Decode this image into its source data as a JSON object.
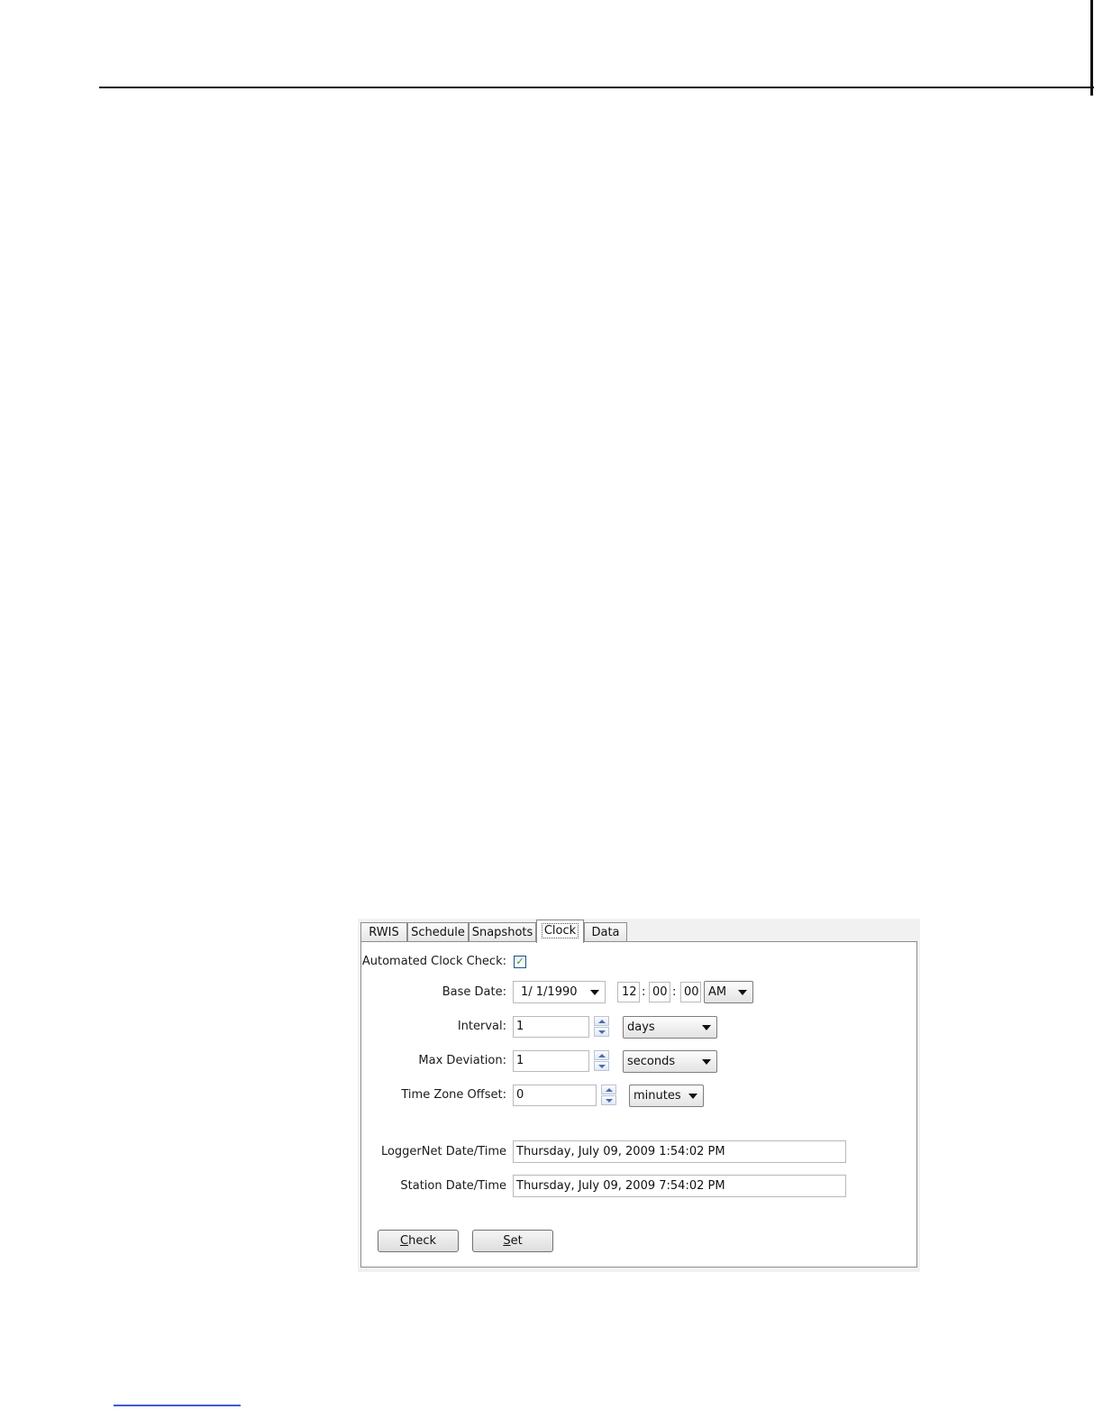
{
  "tabs": [
    "RWIS",
    "Schedule",
    "Snapshots",
    "Clock",
    "Data"
  ],
  "active_tab": "Clock",
  "clock": {
    "automated_label": "Automated Clock Check:",
    "automated_checked": true,
    "check_glyph": "✓",
    "base_date_label": "Base Date:",
    "base_date_value": "1/  1/1990",
    "hour": "12",
    "minute": "00",
    "second": "00",
    "time_sep": ":",
    "ampm": "AM",
    "interval_label": "Interval:",
    "interval_value": "1",
    "interval_unit": "days",
    "max_dev_label": "Max Deviation:",
    "max_dev_value": "1",
    "max_dev_unit": "seconds",
    "tz_label": "Time Zone Offset:",
    "tz_value": "0",
    "tz_unit": "minutes",
    "loggernet_label": "LoggerNet Date/Time",
    "loggernet_value": "Thursday, July 09, 2009 1:54:02 PM",
    "station_label": "Station Date/Time",
    "station_value": "Thursday, July 09, 2009 7:54:02 PM"
  },
  "buttons": {
    "check_mnemonic": "C",
    "check_rest": "heck",
    "set_mnemonic": "S",
    "set_rest": "et"
  },
  "colors": {
    "checkmark": "#21a121",
    "footnote_rule": "#3d5bd6"
  }
}
